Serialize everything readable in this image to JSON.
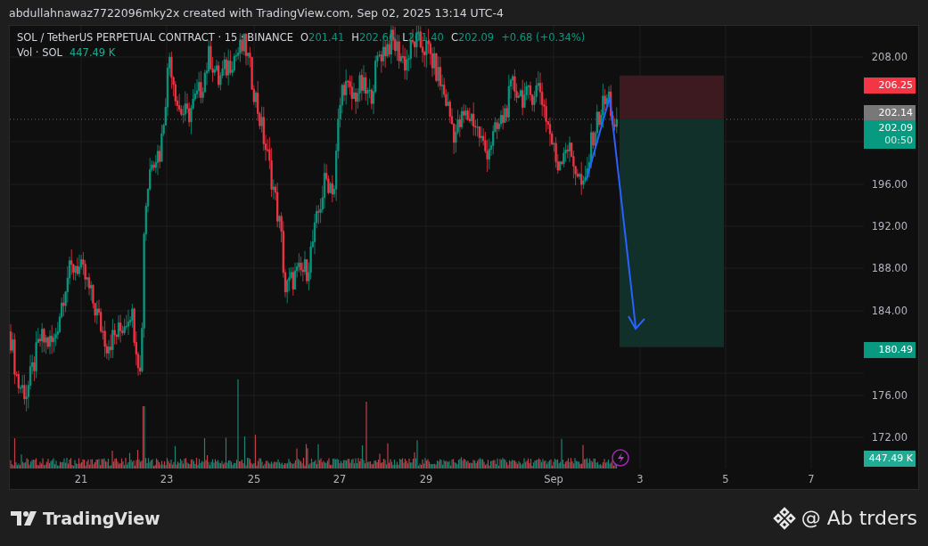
{
  "header": {
    "caption": "abdullahnawaz7722096mky2x created with TradingView.com, Sep 02, 2025 13:14 UTC-4"
  },
  "legend": {
    "symbol": "SOL / TetherUS PERPETUAL CONTRACT · 15 · BINANCE",
    "ohlc": [
      {
        "key": "O",
        "value": "201.41"
      },
      {
        "key": "H",
        "value": "202.66"
      },
      {
        "key": "L",
        "value": "201.40"
      },
      {
        "key": "C",
        "value": "202.09"
      }
    ],
    "change": "+0.68 (+0.34%)",
    "volume_label": "Vol · SOL",
    "volume_value": "447.49 K"
  },
  "price_axis": {
    "ticks": [
      "208.00",
      "196.00",
      "192.00",
      "188.00",
      "184.00",
      "176.00",
      "172.00"
    ]
  },
  "price_markers": [
    {
      "kind": "stop",
      "text": "206.25"
    },
    {
      "kind": "average",
      "text": "202.14"
    },
    {
      "kind": "last",
      "text": "202.09",
      "countdown": "00:50"
    },
    {
      "kind": "target",
      "text": "180.49"
    },
    {
      "kind": "volume",
      "text": "447.49 K"
    }
  ],
  "time_axis": {
    "ticks": [
      "21",
      "23",
      "25",
      "27",
      "29",
      "Sep",
      "3",
      "5",
      "7"
    ]
  },
  "footer": {
    "brand": "TradingView",
    "author": "@ Ab trders"
  }
}
